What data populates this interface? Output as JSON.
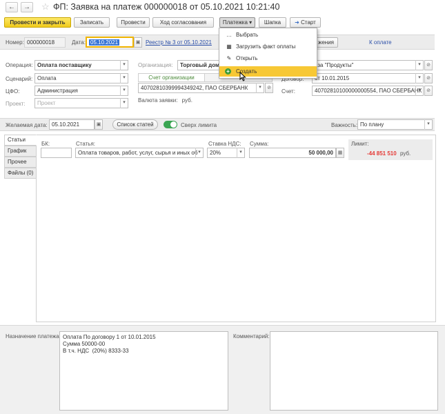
{
  "window": {
    "title": "ФП: Заявка на платеж 000000018 от 05.10.2021 10:21:40",
    "back_glyph": "←",
    "forward_glyph": "→",
    "star_glyph": "☆"
  },
  "toolbar": {
    "post_close": "Провести и закрыть",
    "save": "Записать",
    "post": "Провести",
    "approval": "Ход согласования",
    "payments": "Платежка",
    "header": "Шапка",
    "start": "Старт",
    "start_glyph": "➜",
    "dropdown_glyph": "▾"
  },
  "payments_menu": {
    "items": [
      {
        "label": "Выбрать",
        "icon": "…"
      },
      {
        "label": "Загрузить факт оплаты",
        "icon": "▦"
      },
      {
        "label": "Открыть",
        "icon": "✎"
      },
      {
        "label": "Создать",
        "icon": "+"
      }
    ]
  },
  "header_row": {
    "number_label": "Номер:",
    "number_value": "000000018",
    "date_label": "Дата:",
    "date_value": "05.10.2021",
    "calendar_glyph": "▣",
    "registry_link": "Реестр № 3 от 05.10.2021",
    "right_button_partial": "жения",
    "status_link": "К оплате"
  },
  "fields": {
    "operation_label": "Операция:",
    "operation_value": "Оплата поставщику",
    "scenario_label": "Сценарий:",
    "scenario_value": "Оплата",
    "cfo_label": "ЦФО:",
    "cfo_value": "Администрация",
    "project_label": "Проект:",
    "project_value": "Проект",
    "organization_label": "Организация:",
    "organization_value": "Торговый дом",
    "org_tab": "Счет организации",
    "org_account": "40702810399994349242, ПАО СБЕРБАНК",
    "currency_label": "Валюта заявки:",
    "currency_value": "руб.",
    "counterparty_partial": "аза \"Продукты\"",
    "contract_label": "Договор:",
    "contract_value": "от 10.01.2015",
    "account_label": "Счет:",
    "account_value": "40702810100000000554, ПАО СБЕРБАНК",
    "link_glyph": "⊘",
    "dropdown_glyph": "▾"
  },
  "mid_row": {
    "desired_date_label": "Желаемая дата:",
    "desired_date_value": "05.10.2021",
    "articles_button": "Список статей",
    "over_limit_label": "Сверх лимита",
    "importance_label": "Важность:",
    "importance_value": "По плану"
  },
  "side_tabs": [
    "Статьи",
    "График",
    "Прочее",
    "Файлы (0)"
  ],
  "articles_panel": {
    "bk_label": "БК:",
    "article_label": "Статья:",
    "article_value": "Оплата товаров, работ, услуг, сырья и иных об",
    "vat_label": "Ставка НДС:",
    "vat_value": "20%",
    "sum_label": "Сумма:",
    "sum_value": "50 000,00",
    "calc_glyph": "▦",
    "limit_label": "Лимит:",
    "limit_value": "-44 851 510",
    "limit_currency": "руб."
  },
  "bottom": {
    "purpose_label": "Назначение платежа:",
    "purpose_text": "Оплата По договору 1 от 10.01.2015\nСумма 50000-00\nВ т.ч. НДС  (20%) 8333-33",
    "comment_label": "Комментарий:"
  },
  "colors": {
    "primary_button": "#f1cb1c",
    "link": "#2b4fa8",
    "limit_negative": "#e53935",
    "tab_active_text": "#4b8a3a",
    "menu_highlight": "#f7c835",
    "toggle_on": "#3aa552"
  }
}
